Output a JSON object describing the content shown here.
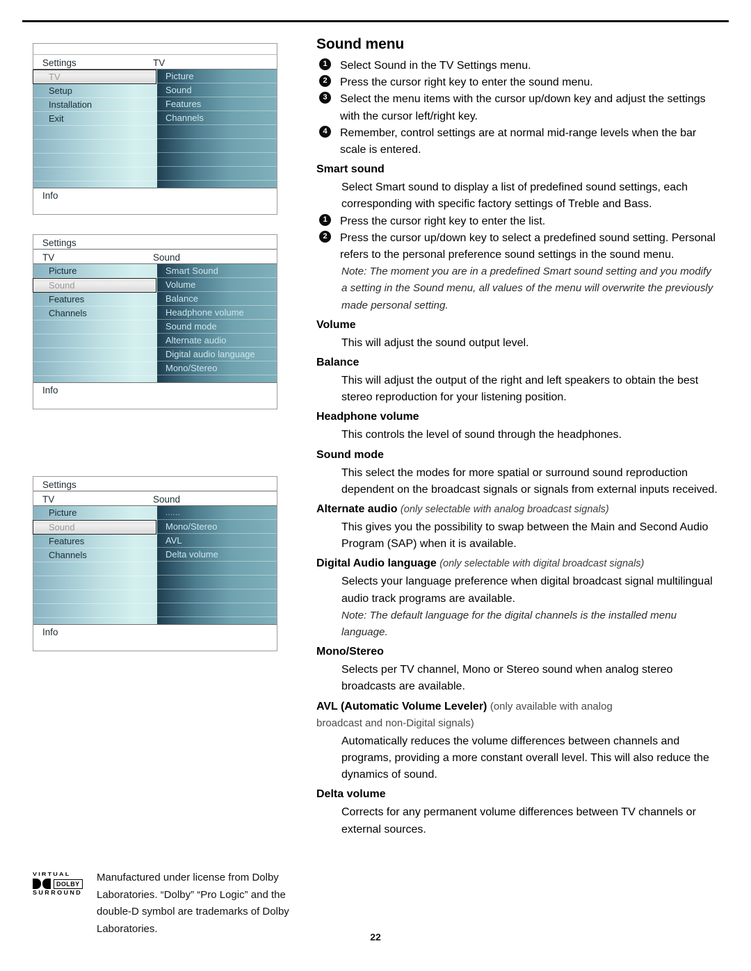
{
  "page": {
    "number": "22"
  },
  "osd_menus": [
    {
      "name": "menu-tv-settings",
      "has_top_strip": true,
      "title_left": "Settings",
      "title_right": "TV",
      "info_label": "Info",
      "left_items": [
        {
          "label": "TV",
          "selected": true
        },
        {
          "label": "Setup",
          "selected": false
        },
        {
          "label": "Installation",
          "selected": false
        },
        {
          "label": "Exit",
          "selected": false
        },
        {
          "label": "",
          "selected": false
        },
        {
          "label": "",
          "selected": false
        },
        {
          "label": "",
          "selected": false
        },
        {
          "label": "",
          "selected": false
        }
      ],
      "right_items": [
        {
          "label": "Picture"
        },
        {
          "label": "Sound"
        },
        {
          "label": "Features"
        },
        {
          "label": "Channels"
        },
        {
          "label": ""
        },
        {
          "label": ""
        },
        {
          "label": ""
        },
        {
          "label": ""
        }
      ]
    },
    {
      "name": "menu-sound-list",
      "has_top_strip": false,
      "title_left": "TV",
      "title_right": "Sound",
      "header_label": "Settings",
      "info_label": "Info",
      "left_items": [
        {
          "label": "Picture",
          "selected": false
        },
        {
          "label": "Sound",
          "selected": true
        },
        {
          "label": "Features",
          "selected": false
        },
        {
          "label": "Channels",
          "selected": false
        },
        {
          "label": "",
          "selected": false
        },
        {
          "label": "",
          "selected": false
        },
        {
          "label": "",
          "selected": false
        },
        {
          "label": "",
          "selected": false
        }
      ],
      "right_items": [
        {
          "label": "Smart Sound"
        },
        {
          "label": "Volume"
        },
        {
          "label": "Balance"
        },
        {
          "label": "Headphone volume"
        },
        {
          "label": "Sound mode"
        },
        {
          "label": "Alternate audio"
        },
        {
          "label": "Digital audio language"
        },
        {
          "label": "Mono/Stereo"
        }
      ]
    },
    {
      "name": "menu-sound-list-scrolled",
      "has_top_strip": false,
      "title_left": "TV",
      "title_right": "Sound",
      "header_label": "Settings",
      "info_label": "Info",
      "left_items": [
        {
          "label": "Picture",
          "selected": false
        },
        {
          "label": "Sound",
          "selected": true
        },
        {
          "label": "Features",
          "selected": false
        },
        {
          "label": "Channels",
          "selected": false
        },
        {
          "label": "",
          "selected": false
        },
        {
          "label": "",
          "selected": false
        },
        {
          "label": "",
          "selected": false
        },
        {
          "label": "",
          "selected": false
        }
      ],
      "right_items": [
        {
          "label": "......",
          "dots": true
        },
        {
          "label": "Mono/Stereo"
        },
        {
          "label": "AVL"
        },
        {
          "label": "Delta volume"
        },
        {
          "label": ""
        },
        {
          "label": ""
        },
        {
          "label": ""
        },
        {
          "label": ""
        }
      ]
    }
  ],
  "article": {
    "title": "Sound menu",
    "intro_steps": [
      {
        "num": "1",
        "text": "Select Sound in the TV Settings menu."
      },
      {
        "num": "2",
        "text": "Press the cursor right key to enter the sound menu."
      },
      {
        "num": "3",
        "text": "Select the menu items with the cursor up/down key and adjust the settings with the cursor left/right key."
      },
      {
        "num": "4",
        "text": "Remember, control settings are at normal mid-range levels when the bar scale is entered."
      }
    ],
    "smart_sound": {
      "heading": "Smart sound",
      "body": "Select Smart sound to display a list of predefined sound settings, each corresponding with specific factory settings of Treble and Bass.",
      "steps": [
        {
          "num": "1",
          "text": "Press the cursor right key to enter the list."
        },
        {
          "num": "2",
          "text": "Press the cursor up/down key to select a predefined sound setting. Personal refers to the personal preference sound settings in the sound menu."
        }
      ],
      "note": "Note: The moment you are in a predefined Smart sound setting and you modify a setting in the Sound menu, all values of the menu will overwrite the previously made personal setting."
    },
    "volume": {
      "heading": "Volume",
      "body": "This will adjust the sound output level."
    },
    "balance": {
      "heading": "Balance",
      "body": "This will adjust the output of the right and left speakers to obtain the best stereo reproduction for your listening position."
    },
    "headphone_volume": {
      "heading": "Headphone volume",
      "body": "This controls the level of sound through the headphones."
    },
    "sound_mode": {
      "heading": "Sound mode",
      "body": "This select the modes for more spatial or surround sound reproduction dependent on the broadcast signals or signals from external inputs received."
    },
    "alternate_audio": {
      "heading": "Alternate audio",
      "qualifier": "(only selectable with analog broadcast signals)",
      "body": "This gives you the possibility to swap between the Main and Second Audio Program (SAP) when it is available."
    },
    "digital_audio_language": {
      "heading": "Digital Audio language",
      "qualifier": "(only selectable with digital broadcast signals)",
      "body": "Selects your language preference when digital broadcast signal multilingual audio track programs are available.",
      "note": "Note: The default language for the digital channels is the installed menu language."
    },
    "mono_stereo": {
      "heading": "Mono/Stereo",
      "body": "Selects per TV channel, Mono or Stereo sound when analog stereo broadcasts are available."
    },
    "avl": {
      "heading": "AVL (Automatic Volume Leveler)",
      "qualifier": "(only available with analog",
      "qualifier_cont": "broadcast and non-Digital signals)",
      "body": "Automatically reduces the volume differences between channels and programs, providing a more constant overall level. This will also reduce the dynamics of sound."
    },
    "delta_volume": {
      "heading": "Delta volume",
      "body": "Corrects for any permanent volume differences between TV channels or external sources."
    }
  },
  "dolby": {
    "virtual": "VIRTUAL",
    "brand": "DOLBY",
    "surround": "SURROUND",
    "text": "Manufactured under license from Dolby Laboratories. “Dolby” “Pro Logic” and the double-D symbol are trademarks of Dolby Laboratories."
  }
}
